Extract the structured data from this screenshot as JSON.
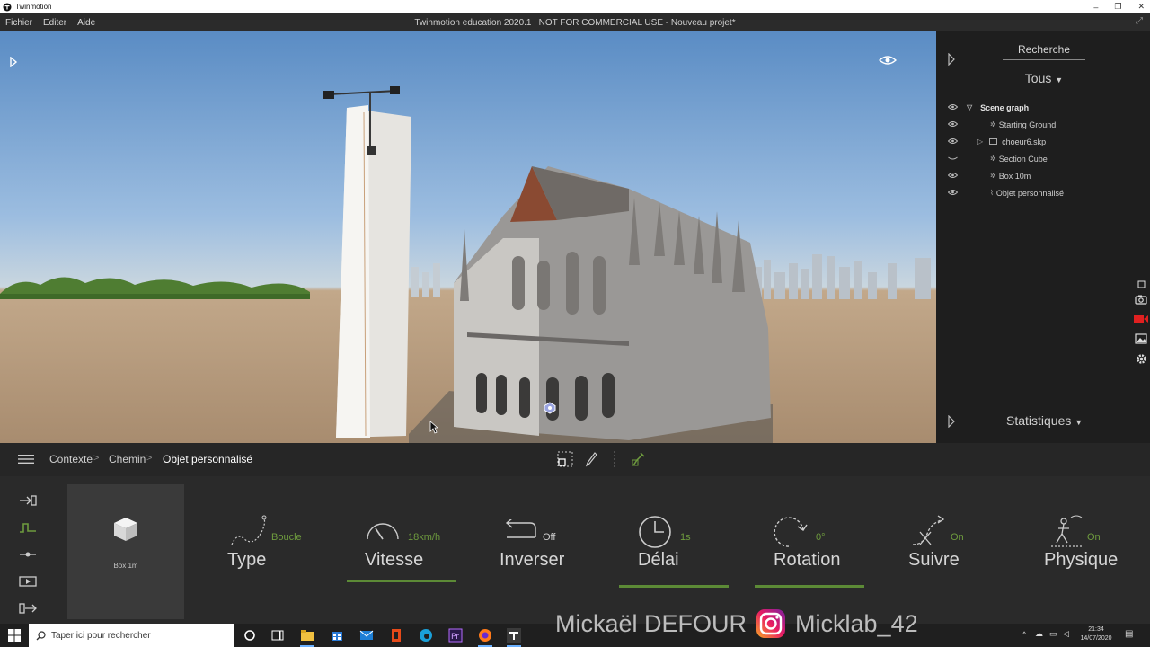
{
  "window": {
    "app_name": "Twinmotion",
    "project_title": "Twinmotion education 2020.1 | NOT FOR COMMERCIAL USE - Nouveau projet*",
    "controls": {
      "minimize": "–",
      "restore": "❐",
      "close": "✕"
    }
  },
  "menu": {
    "items": [
      "Fichier",
      "Editer",
      "Aide"
    ]
  },
  "right_panel": {
    "search_tab": "Recherche",
    "filter": "Tous",
    "tree": [
      {
        "label": "Scene graph",
        "root": true,
        "visible": true
      },
      {
        "label": "Starting Ground",
        "icon": "node-icon",
        "visible": true
      },
      {
        "label": "choeur6.skp",
        "icon": "folder-icon",
        "expandable": true,
        "visible": true
      },
      {
        "label": "Section Cube",
        "icon": "node-icon",
        "visible": false
      },
      {
        "label": "Box 10m",
        "icon": "node-icon",
        "visible": true
      },
      {
        "label": "Objet personnalisé",
        "icon": "path-icon",
        "visible": true
      }
    ],
    "statistics": "Statistiques"
  },
  "breadcrumb": {
    "items": [
      "Contexte",
      "Chemin",
      "Objet personnalisé"
    ]
  },
  "thumbnail": {
    "label": "Box 1m"
  },
  "params": {
    "type": {
      "label": "Type",
      "value": "Boucle"
    },
    "speed": {
      "label": "Vitesse",
      "value": "18km/h",
      "level": 0.45
    },
    "reverse": {
      "label": "Inverser",
      "value": "Off"
    },
    "delay": {
      "label": "Délai",
      "value": "1s",
      "level": 0.55
    },
    "rotation": {
      "label": "Rotation",
      "value": "0°",
      "level": 0.5
    },
    "follow": {
      "label": "Suivre",
      "value": "On"
    },
    "physics": {
      "label": "Physique",
      "value": "On"
    }
  },
  "taskbar": {
    "search_placeholder": "Taper ici pour rechercher",
    "time": "21:34",
    "date": "14/07/2020"
  },
  "watermark": {
    "author": "Mickaël DEFOUR",
    "handle": "Micklab_42"
  },
  "colors": {
    "accent_green": "#6e9b3e",
    "bar_green": "#5c8a36",
    "record_red": "#e02020"
  }
}
